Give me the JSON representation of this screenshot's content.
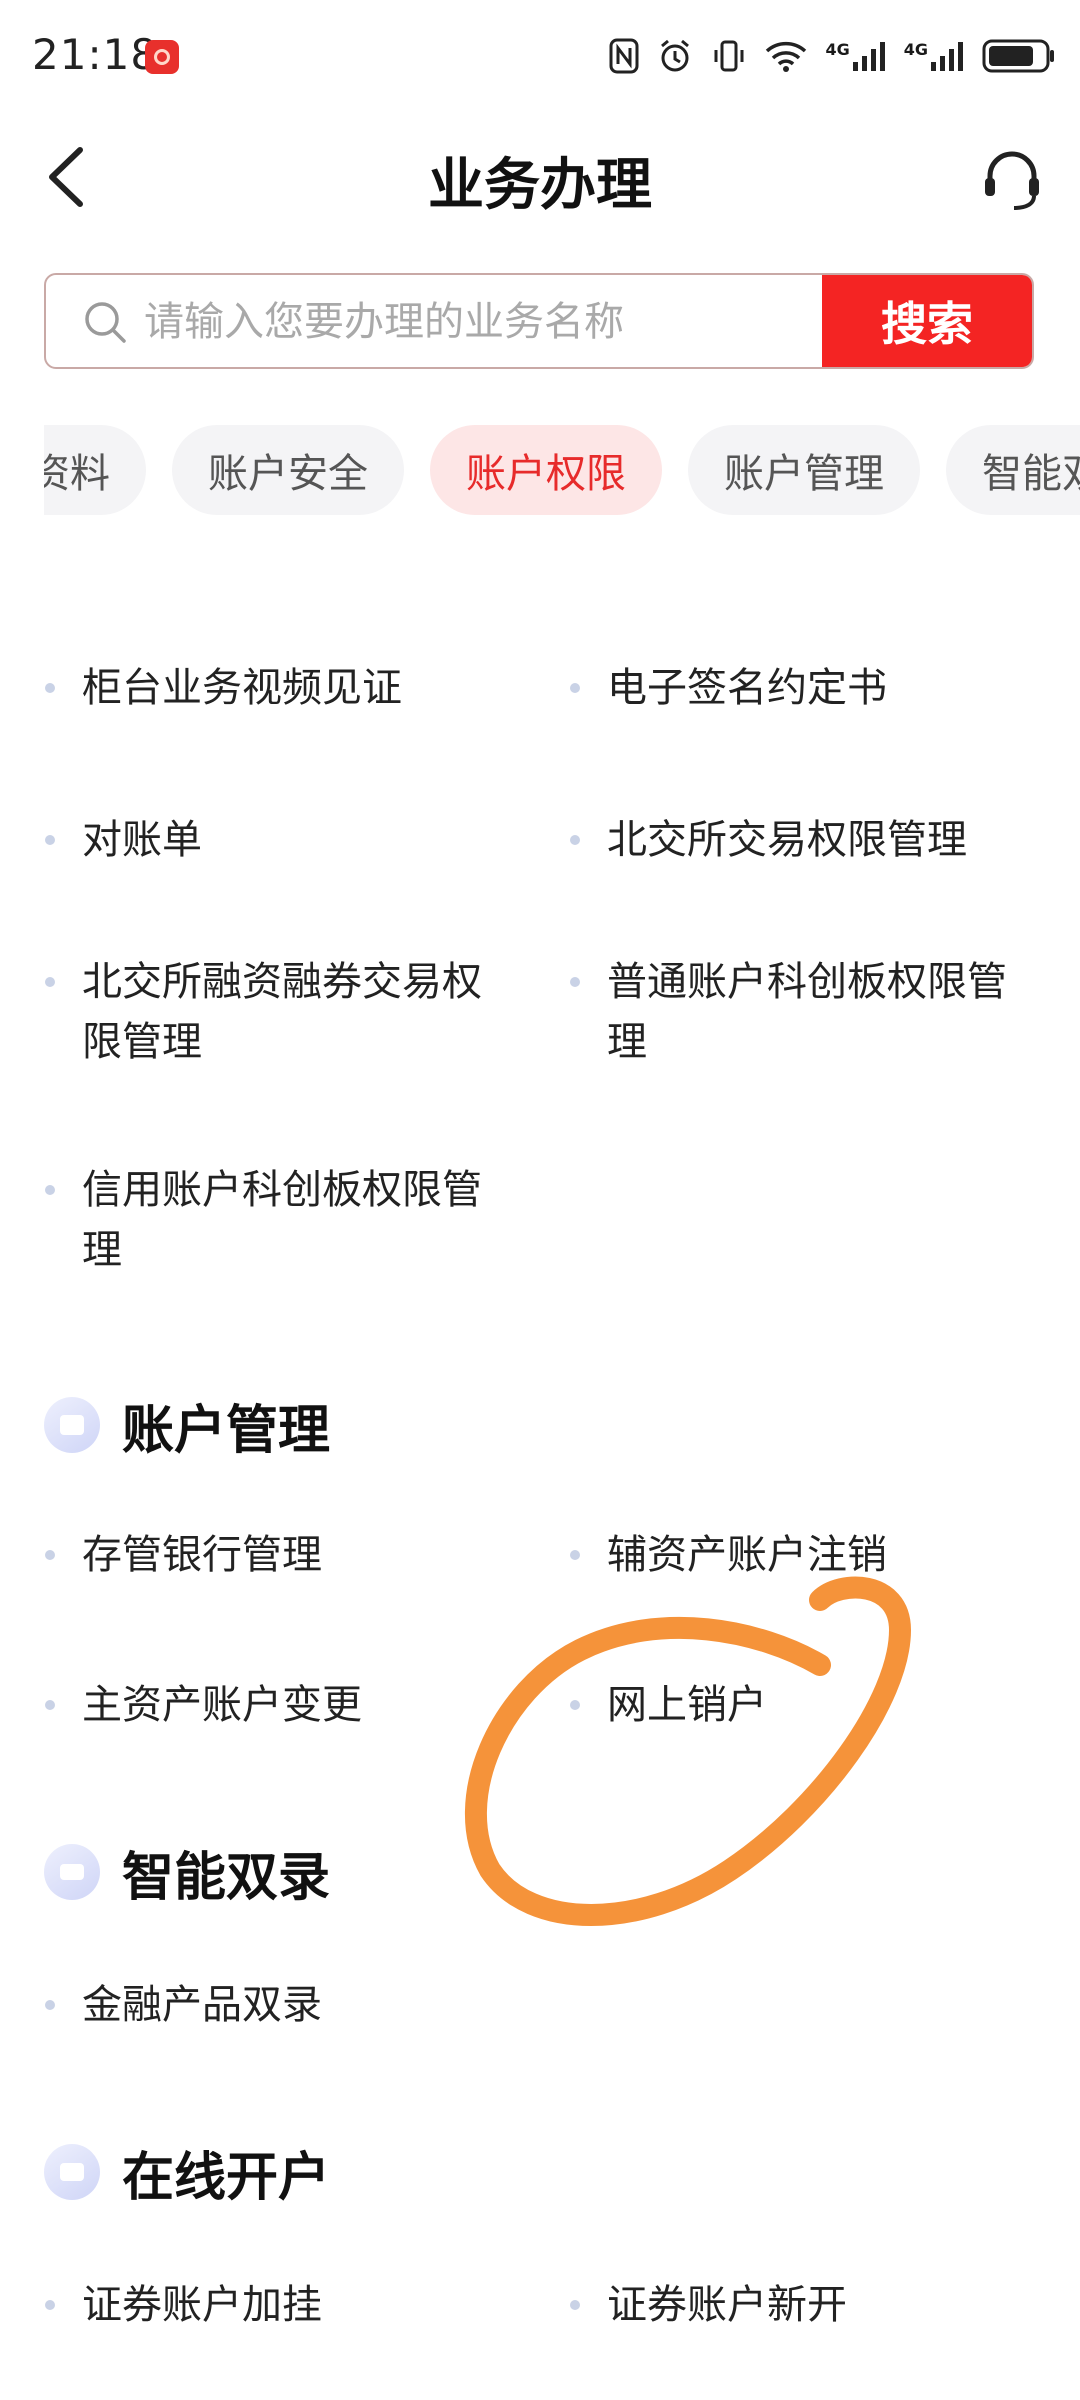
{
  "status_bar": {
    "time": "21:18",
    "network1": "4G",
    "network2": "4G"
  },
  "header": {
    "title": "业务办理"
  },
  "search": {
    "placeholder": "请输入您要办理的业务名称",
    "button_label": "搜索"
  },
  "tabs": [
    {
      "label": "客户资料",
      "active": false
    },
    {
      "label": "账户安全",
      "active": false
    },
    {
      "label": "账户权限",
      "active": true
    },
    {
      "label": "账户管理",
      "active": false
    },
    {
      "label": "智能双录",
      "active": false
    }
  ],
  "sections": {
    "account_permissions": {
      "items": [
        "柜台业务视频见证",
        "电子签名约定书",
        "对账单",
        "北交所交易权限管理",
        "北交所融资融券交易权限管理",
        "普通账户科创板权限管理",
        "信用账户科创板权限管理"
      ]
    },
    "account_management": {
      "title": "账户管理",
      "items": [
        "存管银行管理",
        "辅资产账户注销",
        "主资产账户变更",
        "网上销户"
      ]
    },
    "smart_recording": {
      "title": "智能双录",
      "items": [
        "金融产品双录"
      ]
    },
    "online_account": {
      "title": "在线开户",
      "items": [
        "证券账户加挂",
        "证券账户新开"
      ]
    }
  },
  "annotation": {
    "color": "#f5933a",
    "icon": "freehand-circle"
  },
  "colors": {
    "accent": "#f42423",
    "tab_active_bg": "#fde6e6",
    "tab_active_text": "#e72b2b"
  }
}
